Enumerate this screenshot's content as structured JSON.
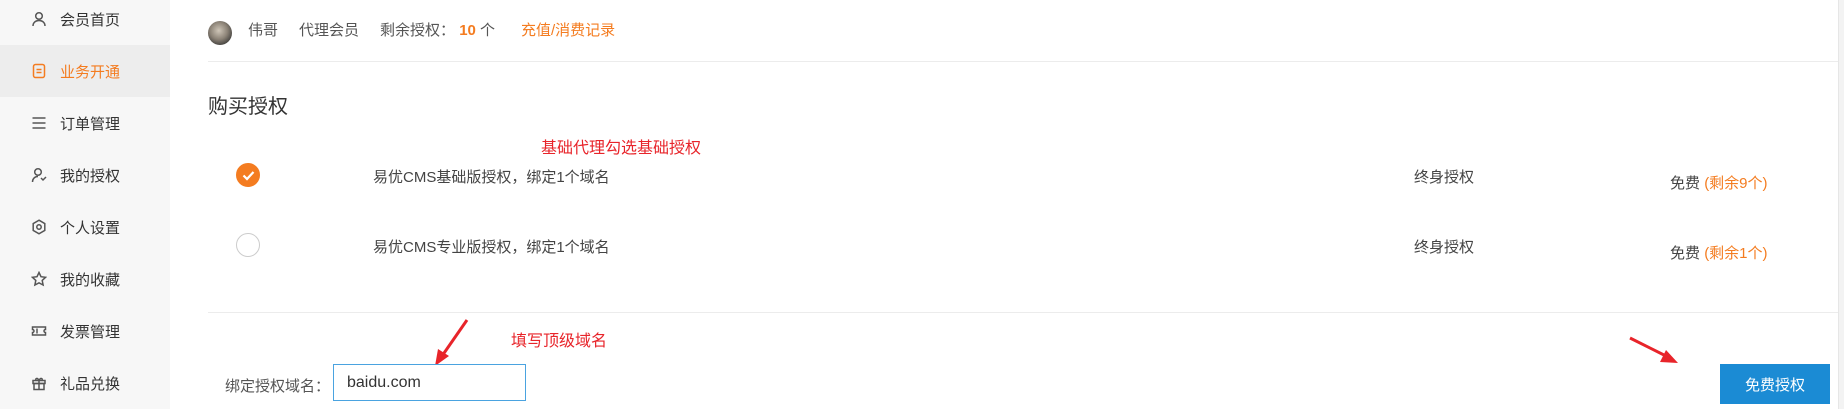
{
  "sidebar": {
    "items": [
      {
        "label": "会员首页",
        "icon": "user-icon"
      },
      {
        "label": "业务开通",
        "icon": "document-icon",
        "active": true
      },
      {
        "label": "订单管理",
        "icon": "list-icon"
      },
      {
        "label": "我的授权",
        "icon": "user-key-icon"
      },
      {
        "label": "个人设置",
        "icon": "settings-icon"
      },
      {
        "label": "我的收藏",
        "icon": "star-icon"
      },
      {
        "label": "发票管理",
        "icon": "ticket-icon"
      },
      {
        "label": "礼品兑换",
        "icon": "gift-icon"
      }
    ]
  },
  "user": {
    "name": "伟哥",
    "role": "代理会员",
    "remaining_label": "剩余授权：",
    "remaining_count": "10",
    "remaining_unit": "个",
    "records_link": "充值/消费记录"
  },
  "purchase": {
    "title": "购买授权",
    "annotation_top": "基础代理勾选基础授权",
    "options": [
      {
        "name": "易优CMS基础版授权，绑定1个域名",
        "term": "终身授权",
        "price": "免费",
        "remaining": "(剩余9个)",
        "checked": true
      },
      {
        "name": "易优CMS专业版授权，绑定1个域名",
        "term": "终身授权",
        "price": "免费",
        "remaining": "(剩余1个)",
        "checked": false
      }
    ],
    "annotation_domain": "填写顶级域名",
    "domain_label": "绑定授权域名：",
    "domain_value": "baidu.com",
    "submit_label": "免费授权"
  },
  "colors": {
    "accent": "#f47c20",
    "button": "#1b8bd4",
    "annotation": "#e8242a",
    "input_border": "#4aa3e0"
  }
}
